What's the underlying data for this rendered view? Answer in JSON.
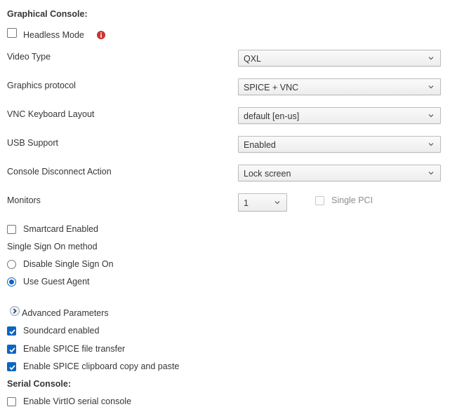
{
  "graphical_console": {
    "title": "Graphical Console:",
    "headless_mode": {
      "label": "Headless Mode",
      "checked": false,
      "info_icon": "info-circle-icon"
    },
    "video_type": {
      "label": "Video Type",
      "value": "QXL"
    },
    "graphics_protocol": {
      "label": "Graphics protocol",
      "value": "SPICE + VNC"
    },
    "vnc_keyboard_layout": {
      "label": "VNC Keyboard Layout",
      "value": "default [en-us]"
    },
    "usb_support": {
      "label": "USB Support",
      "value": "Enabled"
    },
    "console_disconnect_action": {
      "label": "Console Disconnect Action",
      "value": "Lock screen"
    },
    "monitors": {
      "label": "Monitors",
      "value": "1"
    },
    "single_pci": {
      "label": "Single PCI",
      "checked": false,
      "disabled": true
    },
    "smartcard_enabled": {
      "label": "Smartcard Enabled",
      "checked": false
    },
    "sso": {
      "label": "Single Sign On method",
      "options": [
        {
          "label": "Disable Single Sign On",
          "selected": false
        },
        {
          "label": "Use Guest Agent",
          "selected": true
        }
      ]
    },
    "advanced_parameters": {
      "label": "Advanced Parameters",
      "icon": "chevron-right-circle-icon"
    },
    "soundcard_enabled": {
      "label": "Soundcard enabled",
      "checked": true
    },
    "spice_file_transfer": {
      "label": "Enable SPICE file transfer",
      "checked": true
    },
    "spice_clipboard": {
      "label": "Enable SPICE clipboard copy and paste",
      "checked": true
    }
  },
  "serial_console": {
    "title": "Serial Console:",
    "virtio_serial": {
      "label": "Enable VirtIO serial console",
      "checked": false
    }
  },
  "colors": {
    "accent": "#0b65c2",
    "info_icon": "#cc3333",
    "text": "#363636"
  }
}
